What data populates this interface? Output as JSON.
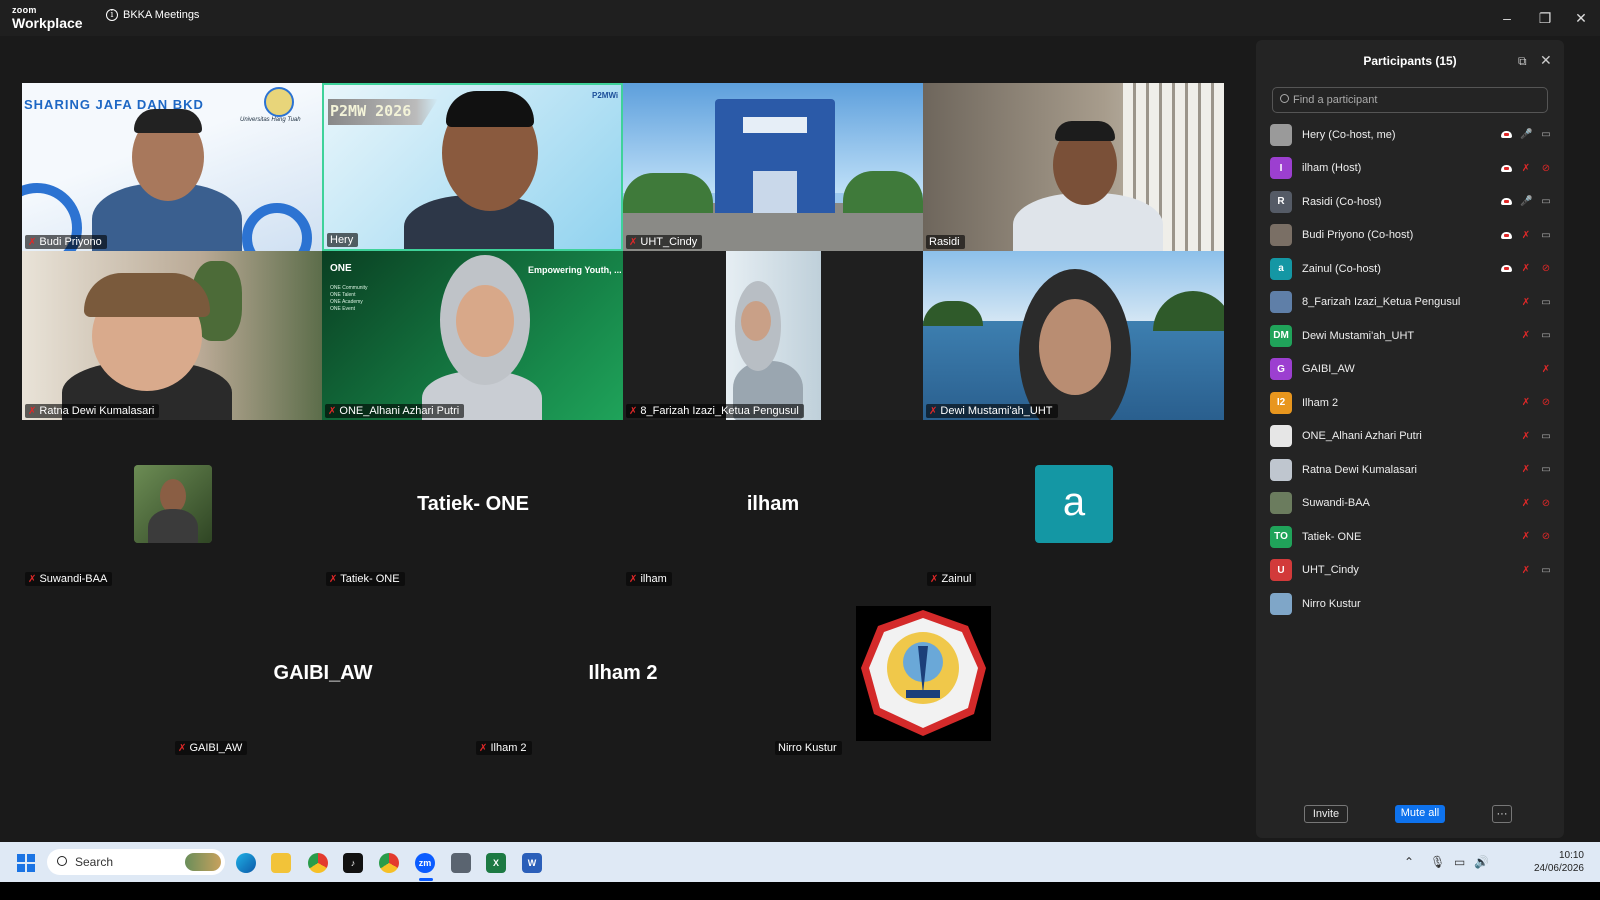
{
  "app": {
    "brand_small": "zoom",
    "brand_big": "Workplace",
    "meeting_title": "BKKA Meetings",
    "controls": {
      "minimize": "–",
      "restore": "❐",
      "close": "✕"
    }
  },
  "video_tiles": [
    {
      "name": "Budi Priyono",
      "muted": true,
      "slide_title": "SHARING JAFA  DAN BKD",
      "slide_sub": "Universitas Hang Tuah"
    },
    {
      "name": "Hery",
      "muted": false,
      "slide_title": "P2MW 2026",
      "logo_text": "P2MWi"
    },
    {
      "name": "UHT_Cindy",
      "muted": true
    },
    {
      "name": "Rasidi",
      "muted": false
    },
    {
      "name": "Ratna Dewi Kumalasari",
      "muted": true
    },
    {
      "name": "ONE_Alhani Azhari Putri",
      "muted": true,
      "slide_title": "ONE",
      "slide_heading": "Empowering Youth, ...ing Future Leaders",
      "bullets": [
        "ONE Community",
        "ONE Talent",
        "ONE Academy",
        "ONE Event"
      ]
    },
    {
      "name": "8_Farizah Izazi_Ketua Pengusul",
      "muted": true
    },
    {
      "name": "Dewi Mustami'ah_UHT",
      "muted": true
    }
  ],
  "avatar_tiles": [
    {
      "name": "Suwandi-BAA",
      "label": "Suwandi-BAA",
      "muted": true
    },
    {
      "name": "Tatiek- ONE",
      "label": "Tatiek- ONE",
      "muted": true
    },
    {
      "name": "ilham",
      "label": "ilham",
      "muted": true
    },
    {
      "name": "Zainul",
      "label": "Zainul",
      "letter": "a",
      "muted": true
    },
    {
      "name": "GAIBI_AW",
      "label": "GAIBI_AW",
      "muted": true
    },
    {
      "name": "Ilham 2",
      "label": "Ilham 2",
      "muted": true
    },
    {
      "name": "Nirro Kustur",
      "label": "Nirro Kustur",
      "muted": false,
      "logo_text": "UNIVERSITAS HANG TUAH SURABAYA"
    }
  ],
  "participants_panel": {
    "title": "Participants (15)",
    "search_placeholder": "Find a participant",
    "invite_label": "Invite",
    "mute_all_label": "Mute all",
    "more_label": "···",
    "participants": [
      {
        "name": "Hery (Co-host, me)",
        "avatar": "",
        "color": "#9a9a9a",
        "cloud": true,
        "mic": "on",
        "cam": "on"
      },
      {
        "name": "ilham (Host)",
        "avatar": "I",
        "color": "#9c3fd0",
        "cloud": true,
        "mic": "muted",
        "cam": "off"
      },
      {
        "name": "Rasidi (Co-host)",
        "avatar": "R",
        "color": "#555b66",
        "cloud": true,
        "mic": "on",
        "cam": "on"
      },
      {
        "name": "Budi Priyono (Co-host)",
        "avatar": "",
        "color": "#7a6f65",
        "cloud": true,
        "mic": "muted",
        "cam": "on"
      },
      {
        "name": "Zainul (Co-host)",
        "avatar": "a",
        "color": "#1497a4",
        "cloud": true,
        "mic": "muted",
        "cam": "off"
      },
      {
        "name": "8_Farizah Izazi_Ketua Pengusul",
        "avatar": "",
        "color": "#5f7fa8",
        "cloud": false,
        "mic": "muted",
        "cam": "on"
      },
      {
        "name": "Dewi Mustami'ah_UHT",
        "avatar": "DM",
        "color": "#20a35a",
        "cloud": false,
        "mic": "muted",
        "cam": "on"
      },
      {
        "name": "GAIBI_AW",
        "avatar": "G",
        "color": "#9c3fd0",
        "cloud": false,
        "mic": "muted",
        "cam": "none"
      },
      {
        "name": "Ilham 2",
        "avatar": "I2",
        "color": "#e8961e",
        "cloud": false,
        "mic": "muted",
        "cam": "off"
      },
      {
        "name": "ONE_Alhani Azhari Putri",
        "avatar": "",
        "color": "#e6e6e6",
        "cloud": false,
        "mic": "muted",
        "cam": "on"
      },
      {
        "name": "Ratna Dewi Kumalasari",
        "avatar": "",
        "color": "#bfc6cf",
        "cloud": false,
        "mic": "muted",
        "cam": "on"
      },
      {
        "name": "Suwandi-BAA",
        "avatar": "",
        "color": "#6b7c5e",
        "cloud": false,
        "mic": "muted",
        "cam": "off"
      },
      {
        "name": "Tatiek- ONE",
        "avatar": "TO",
        "color": "#20a35a",
        "cloud": false,
        "mic": "muted",
        "cam": "off"
      },
      {
        "name": "UHT_Cindy",
        "avatar": "U",
        "color": "#d23a3a",
        "cloud": false,
        "mic": "muted",
        "cam": "on"
      },
      {
        "name": "Nirro Kustur",
        "avatar": "",
        "color": "#7fa6c8",
        "cloud": false,
        "mic": "none",
        "cam": "none"
      }
    ]
  },
  "taskbar": {
    "search_placeholder": "Search",
    "time": "10:10",
    "date": "24/06/2026",
    "apps": [
      "edge",
      "file-explorer",
      "chrome",
      "tiktok",
      "chrome-alt",
      "zoom",
      "app",
      "excel",
      "word"
    ],
    "app_labels": {
      "zoom": "zm",
      "excel": "X",
      "word": "W",
      "tiktok": "♪"
    }
  },
  "colors": {
    "active_speaker_border": "#3fd29a",
    "muted_red": "#e02828",
    "mute_all_blue": "#0e72ed",
    "zainul_tile": "#1497a4"
  }
}
